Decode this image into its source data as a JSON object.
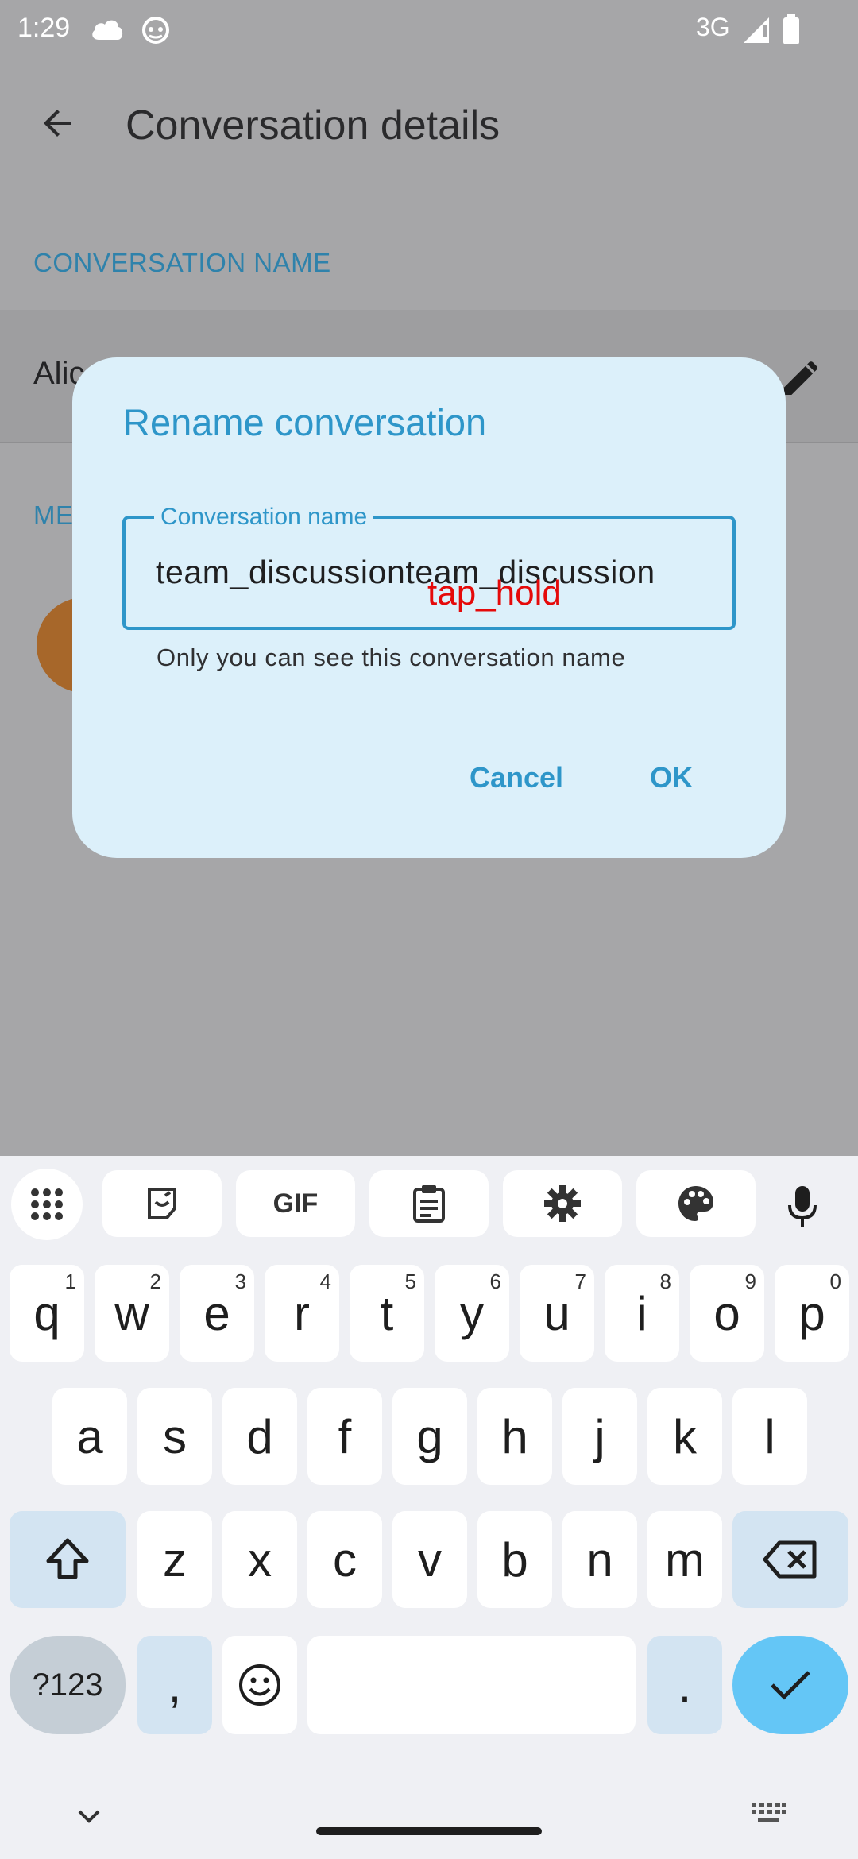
{
  "status_bar": {
    "time": "1:29",
    "network": "3G",
    "icons": [
      "cloud-icon",
      "android-icon",
      "signal-icon",
      "battery-icon"
    ]
  },
  "app_bar": {
    "title": "Conversation details",
    "back_icon": "arrow-back-icon"
  },
  "screen": {
    "section_name_label": "CONVERSATION NAME",
    "name_value_partial": "Alic",
    "section_members_partial": "ME",
    "edit_icon": "pencil-icon"
  },
  "dialog": {
    "title": "Rename conversation",
    "field_label": "Conversation name",
    "field_value": "team_discussionteam_discussion",
    "helper_text": "Only you can see this conversation name",
    "cancel_label": "Cancel",
    "ok_label": "OK",
    "overlay_label": "tap_hold"
  },
  "keyboard": {
    "toolbar": [
      "apps-grid-icon",
      "sticker-icon",
      "GIF",
      "clipboard-icon",
      "gear-icon",
      "palette-icon",
      "mic-icon"
    ],
    "row1": [
      {
        "key": "q",
        "hint": "1"
      },
      {
        "key": "w",
        "hint": "2"
      },
      {
        "key": "e",
        "hint": "3"
      },
      {
        "key": "r",
        "hint": "4"
      },
      {
        "key": "t",
        "hint": "5"
      },
      {
        "key": "y",
        "hint": "6"
      },
      {
        "key": "u",
        "hint": "7"
      },
      {
        "key": "i",
        "hint": "8"
      },
      {
        "key": "o",
        "hint": "9"
      },
      {
        "key": "p",
        "hint": "0"
      }
    ],
    "row2": [
      "a",
      "s",
      "d",
      "f",
      "g",
      "h",
      "j",
      "k",
      "l"
    ],
    "row3": [
      "z",
      "x",
      "c",
      "v",
      "b",
      "n",
      "m"
    ],
    "symbols_label": "?123",
    "comma_label": ",",
    "period_label": ".",
    "colors": {
      "accent": "#2e96c9",
      "enter": "#64c6f6",
      "special": "#d3e4f2",
      "overlay": "#e50a0a"
    }
  }
}
